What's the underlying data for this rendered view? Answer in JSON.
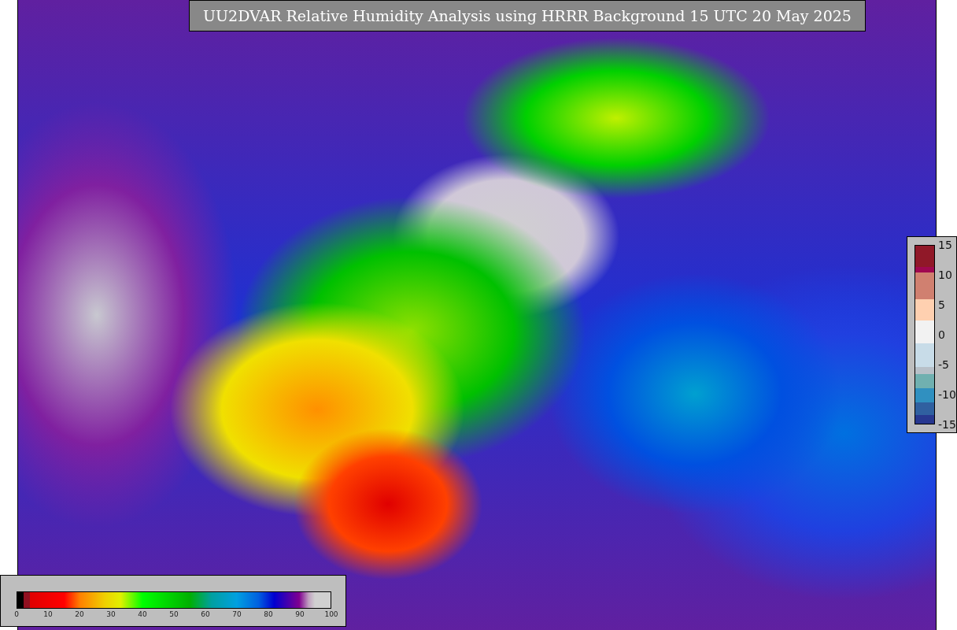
{
  "title": "UU2DVAR Relative Humidity Analysis using HRRR Background 15 UTC 20 May 2025",
  "humidity_scale": {
    "ticks": [
      "0",
      "10",
      "20",
      "30",
      "40",
      "50",
      "60",
      "70",
      "80",
      "90",
      "100"
    ]
  },
  "difference_scale": {
    "ticks": [
      "15",
      "10",
      "5",
      "0",
      "-5",
      "-10",
      "-15"
    ]
  }
}
